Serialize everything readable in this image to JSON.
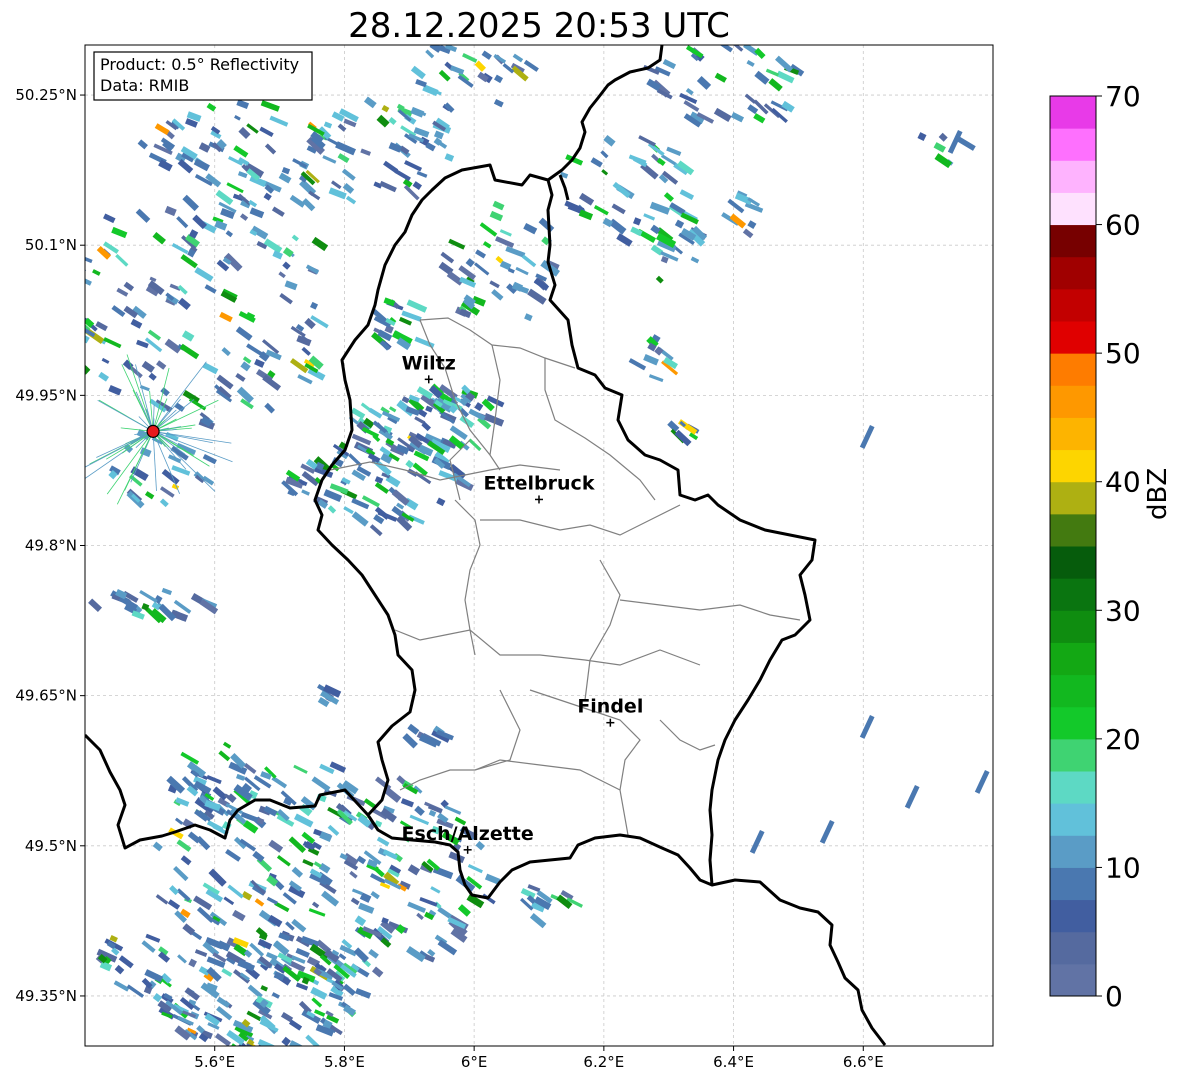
{
  "title": "28.12.2025 20:53 UTC",
  "info_box": {
    "product_line": "Product: 0.5° Reflectivity",
    "data_line": "Data: RMIB"
  },
  "map": {
    "lon_range": [
      5.4,
      6.8
    ],
    "lat_range": [
      49.3,
      50.3
    ],
    "grid": true,
    "lon_ticks": [
      {
        "value": 5.6,
        "label": "5.6°E"
      },
      {
        "value": 5.8,
        "label": "5.8°E"
      },
      {
        "value": 6.0,
        "label": "6°E"
      },
      {
        "value": 6.2,
        "label": "6.2°E"
      },
      {
        "value": 6.4,
        "label": "6.4°E"
      },
      {
        "value": 6.6,
        "label": "6.6°E"
      }
    ],
    "lat_ticks": [
      {
        "value": 50.25,
        "label": "50.25°N"
      },
      {
        "value": 50.1,
        "label": "50.1°N"
      },
      {
        "value": 49.95,
        "label": "49.95°N"
      },
      {
        "value": 49.8,
        "label": "49.8°N"
      },
      {
        "value": 49.65,
        "label": "49.65°N"
      },
      {
        "value": 49.5,
        "label": "49.5°N"
      },
      {
        "value": 49.35,
        "label": "49.35°N"
      }
    ],
    "cities": [
      {
        "name": "Wiltz",
        "lon": 5.93,
        "lat": 49.966
      },
      {
        "name": "Ettelbruck",
        "lon": 6.1,
        "lat": 49.846
      },
      {
        "name": "Findel",
        "lon": 6.21,
        "lat": 49.623
      },
      {
        "name": "Esch/Alzette",
        "lon": 5.99,
        "lat": 49.496
      }
    ],
    "radar_site": {
      "lon": 5.505,
      "lat": 49.914
    }
  },
  "colorbar": {
    "label": "dBZ",
    "min": 0,
    "max": 70,
    "ticks": [
      "0",
      "10",
      "20",
      "30",
      "40",
      "50",
      "60",
      "70"
    ],
    "colors": [
      "#6173a5",
      "#556a9f",
      "#415ea0",
      "#4a78b0",
      "#5a9cc6",
      "#61c1da",
      "#5dd9c4",
      "#3fd372",
      "#13c92a",
      "#12b81f",
      "#13a814",
      "#0f8d10",
      "#0a7510",
      "#065c0c",
      "#437a10",
      "#aeb012",
      "#fdd500",
      "#fdb400",
      "#fe9800",
      "#fe7c00",
      "#e00000",
      "#c20000",
      "#a00000",
      "#770000",
      "#fee1fe",
      "#feb3fe",
      "#fe70fe",
      "#e83ae8"
    ]
  }
}
